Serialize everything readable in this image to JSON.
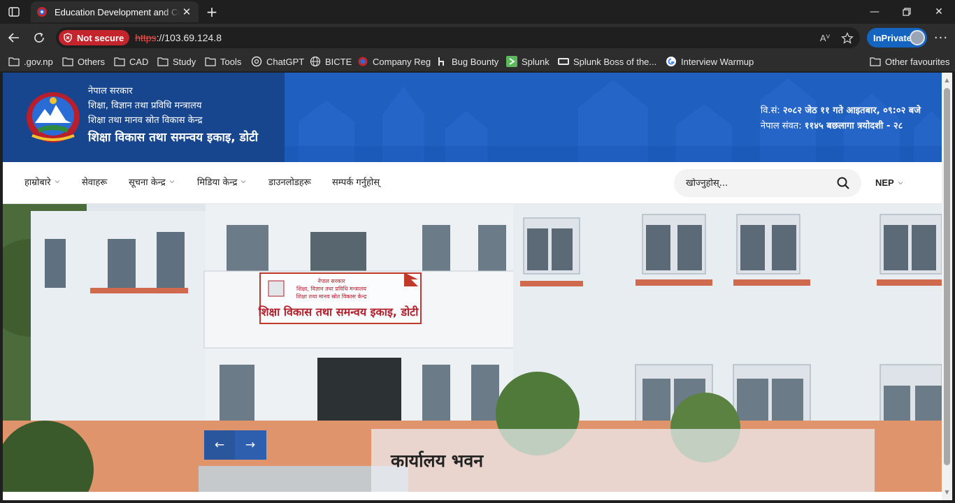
{
  "browser": {
    "tab": {
      "title": "Education Development and Coordination Unit, Doti"
    },
    "address": {
      "not_secure": "Not secure",
      "scheme": "https",
      "host": "://103.69.124.8"
    },
    "read_aloud_icon": "Aⱽ",
    "inprivate": "InPrivate",
    "bookmarks": [
      {
        "label": ".gov.np",
        "icon": "folder-icon"
      },
      {
        "label": "Others",
        "icon": "folder-icon"
      },
      {
        "label": "CAD",
        "icon": "folder-icon"
      },
      {
        "label": "Study",
        "icon": "folder-icon"
      },
      {
        "label": "Tools",
        "icon": "folder-icon"
      },
      {
        "label": "ChatGPT",
        "icon": "chatgpt-icon"
      },
      {
        "label": "BICTE",
        "icon": "globe-icon"
      },
      {
        "label": "Company Reg",
        "icon": "emblem-icon"
      },
      {
        "label": "Bug Bounty",
        "icon": "bugbounty-icon"
      },
      {
        "label": "Splunk",
        "icon": "splunk-icon"
      },
      {
        "label": "Splunk Boss of the...",
        "icon": "boss-icon"
      },
      {
        "label": "Interview Warmup",
        "icon": "google-icon"
      },
      {
        "label": "Other favourites",
        "icon": "folder-icon"
      }
    ]
  },
  "site": {
    "header": {
      "gov": "नेपाल सरकार",
      "ministry": "शिक्षा, विज्ञान तथा प्रविधि मन्त्रालय",
      "center": "शिक्षा तथा मानव स्रोत विकास केन्द्र",
      "office": "शिक्षा विकास तथा समन्वय इकाइ, डोटी",
      "date_prefix": "वि.सं:",
      "date_value": "२०८२ जेठ ११ गते आइतबार, ०९:०२ बजे",
      "nepal_sambat_prefix": "नेपाल संवत:",
      "nepal_sambat_value": "११४५ बछलागा त्रयोदशी - २८"
    },
    "nav": {
      "items": [
        {
          "label": "हाम्रोबारे",
          "dropdown": true
        },
        {
          "label": "सेवाहरू",
          "dropdown": false
        },
        {
          "label": "सूचना केन्द्र",
          "dropdown": true
        },
        {
          "label": "मिडिया केन्द्र",
          "dropdown": true
        },
        {
          "label": "डाउनलोडहरू",
          "dropdown": false
        },
        {
          "label": "सम्पर्क गर्नुहोस्",
          "dropdown": false
        }
      ],
      "search_placeholder": "खोज्नुहोस्...",
      "language": "NEP"
    },
    "hero": {
      "caption": "कार्यालय भवन",
      "prev": "←",
      "next": "→"
    }
  },
  "colors": {
    "header_blue": "#1f5fbf",
    "header_dark": "#17468e",
    "not_secure": "#c4242b",
    "inprivate": "#1565c0"
  }
}
